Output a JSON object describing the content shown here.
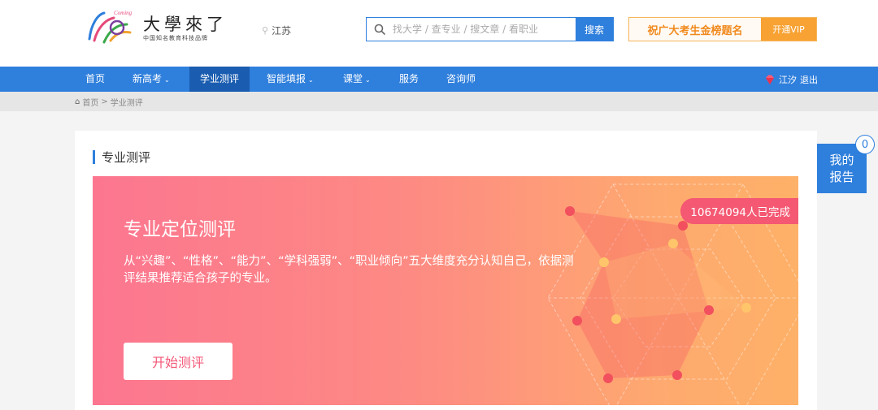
{
  "header": {
    "logo_title": "大學來了",
    "logo_subtitle": "中国知名教育科技品牌",
    "logo_mark_text": "Coming",
    "location": "江苏",
    "search_placeholder": "找大学 / 查专业 / 搜文章 / 看职业",
    "search_button": "搜索",
    "ad_text": "祝广大考生金榜题名",
    "ad_vip": "开通VIP"
  },
  "nav": {
    "items": [
      {
        "label": "首页",
        "caret": ""
      },
      {
        "label": "新高考",
        "caret": "⌄"
      },
      {
        "label": "学业测评",
        "caret": ""
      },
      {
        "label": "智能填报",
        "caret": "⌄"
      },
      {
        "label": "课堂",
        "caret": "⌄"
      },
      {
        "label": "服务",
        "caret": ""
      },
      {
        "label": "咨询师",
        "caret": ""
      }
    ],
    "active_index": 2,
    "user_name": "江汐",
    "logout": "退出"
  },
  "breadcrumb": {
    "home": "首页",
    "separator": ">",
    "current": "学业测评"
  },
  "section": {
    "title": "专业测评"
  },
  "hero": {
    "title": "专业定位测评",
    "description": "从“兴趣”、“性格”、“能力”、“学科强弱”、“职业倾向”五大维度充分认知自己，依据测评结果推荐适合孩子的专业。",
    "button": "开始测评",
    "completed": "10674094人已完成"
  },
  "side": {
    "report_line1": "我的",
    "report_line2": "报告",
    "report_count": "0"
  },
  "colors": {
    "brand_blue": "#2f7fdc",
    "nav_active": "#1a5db0",
    "hero_start": "#fc7690",
    "hero_end": "#feb168",
    "ad_orange": "#f7a233"
  }
}
